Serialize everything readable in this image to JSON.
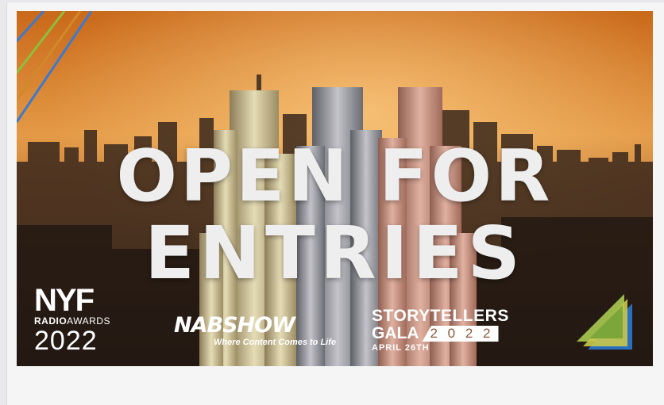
{
  "banner": {
    "headline_line1": "OPEN FOR",
    "headline_line2": "ENTRIES",
    "logo_nyf": {
      "brand": "NYF",
      "line_a": "RADIO",
      "line_b": "AWARDS",
      "year": "2022"
    },
    "logo_nab": {
      "brand": "NABSHOW",
      "tagline": "Where Content Comes to Life"
    },
    "logo_gala": {
      "line1": "STORYTELLERS",
      "line2": "GALA",
      "year": "2 0 2 2",
      "date": "APRIL 26TH"
    },
    "colors": {
      "sky_top": "#d0761e",
      "sky_mid": "#e8a24a",
      "city": "#3a2a1e",
      "gold": "#c8b98c",
      "silver": "#8e8e94",
      "copper": "#c58f7e",
      "stripe_blue": "#3a7ad0",
      "stripe_green": "#8fbf3a",
      "stripe_orange": "#d08a2a",
      "corner_green": "#9cb84a",
      "corner_blue": "#2a6fbf"
    }
  }
}
